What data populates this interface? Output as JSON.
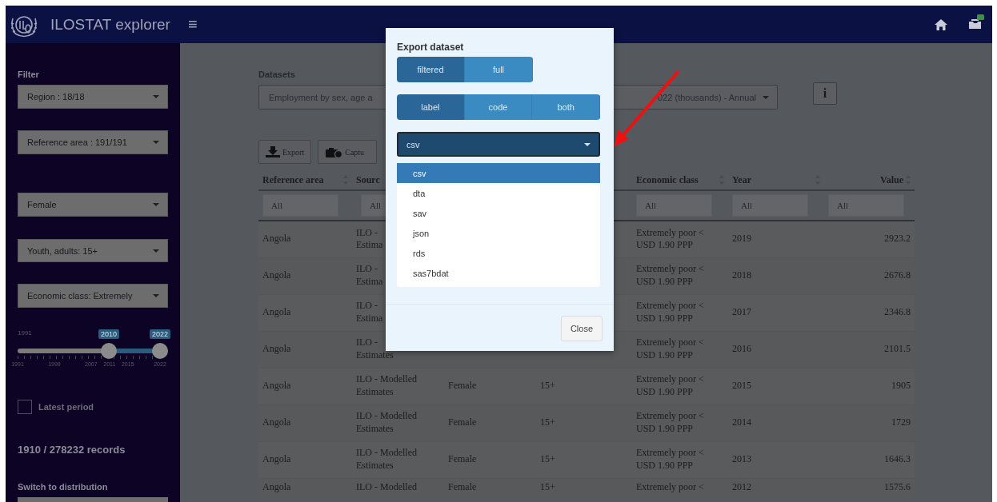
{
  "header": {
    "title": "ILOSTAT explorer",
    "menu_icon": "≡"
  },
  "sidebar": {
    "heading": "Filter",
    "selects": [
      {
        "value": "Region : 18/18"
      },
      {
        "value": "Reference area : 191/191"
      },
      {
        "value": "Female"
      },
      {
        "value": "Youth, adults: 15+"
      },
      {
        "value": "Economic class: Extremely"
      }
    ],
    "year_slider": {
      "min_label": "1991",
      "handles": [
        {
          "label": "2010",
          "level": 0.64
        },
        {
          "label": "2022",
          "level": 1
        }
      ],
      "tick_labels": [
        "1991",
        "1999",
        "2007",
        "2011",
        "2015",
        "2022"
      ]
    },
    "latest_period": {
      "label": "Latest period",
      "checked": false
    },
    "records": "1910 / 278232 records",
    "switch_label": "Switch to distribution"
  },
  "main": {
    "datasets_label": "Datasets",
    "dataset_select": {
      "value_start": "Employment by sex, age a",
      "value_end": "022 (thousands) - Annual"
    },
    "info_button": "i",
    "toolbar": [
      {
        "kind": "export",
        "label": "Export"
      },
      {
        "kind": "capture",
        "label": "Captu"
      }
    ],
    "table": {
      "columns": [
        {
          "label": "Reference area",
          "placeholder": "All"
        },
        {
          "label": "Sourc",
          "placeholder": "All"
        },
        null,
        null,
        {
          "label": "Economic class",
          "placeholder": "All"
        },
        {
          "label": "Year",
          "placeholder": "All"
        },
        {
          "label": "Value",
          "placeholder": "All"
        }
      ],
      "rows": [
        [
          "Angola",
          "ILO -\nEstima",
          null,
          null,
          "Extremely poor <\nUSD 1.90 PPP",
          "2019",
          "2923.2"
        ],
        [
          "Angola",
          "ILO -\nEstima",
          null,
          null,
          "Extremely poor <\nUSD 1.90 PPP",
          "2018",
          "2676.8"
        ],
        [
          "Angola",
          "ILO -\nEstima",
          null,
          null,
          "Extremely poor <\nUSD 1.90 PPP",
          "2017",
          "2346.8"
        ],
        [
          "Angola",
          "ILO -\nEstimates",
          null,
          null,
          "Extremely poor <\nUSD 1.90 PPP",
          "2016",
          "2101.5"
        ],
        [
          "Angola",
          "ILO - Modelled\nEstimates",
          "Female",
          "15+",
          "Extremely poor <\nUSD 1.90 PPP",
          "2015",
          "1905"
        ],
        [
          "Angola",
          "ILO - Modelled\nEstimates",
          "Female",
          "15+",
          "Extremely poor <\nUSD 1.90 PPP",
          "2014",
          "1729"
        ],
        [
          "Angola",
          "ILO - Modelled\nEstimates",
          "Female",
          "15+",
          "Extremely poor <\nUSD 1.90 PPP",
          "2013",
          "1646.3"
        ],
        [
          "Angola",
          "ILO - Modelled",
          "Female",
          "15+",
          "Extremely poor <",
          "2012",
          "1575.6"
        ]
      ]
    }
  },
  "modal": {
    "title": "Export dataset",
    "scope": [
      {
        "label": "filtered",
        "selected": true
      },
      {
        "label": "full",
        "selected": false
      }
    ],
    "labels": [
      {
        "label": "label",
        "selected": true
      },
      {
        "label": "code",
        "selected": false
      },
      {
        "label": "both",
        "selected": false
      }
    ],
    "format_select": {
      "value": "csv",
      "expanded": true
    },
    "format_options": [
      {
        "label": "csv",
        "selected": true
      },
      {
        "label": "dta",
        "selected": false
      },
      {
        "label": "sav",
        "selected": false
      },
      {
        "label": "json",
        "selected": false
      },
      {
        "label": "rds",
        "selected": false
      },
      {
        "label": "sas7bdat",
        "selected": false
      }
    ],
    "close_button": "Close"
  }
}
